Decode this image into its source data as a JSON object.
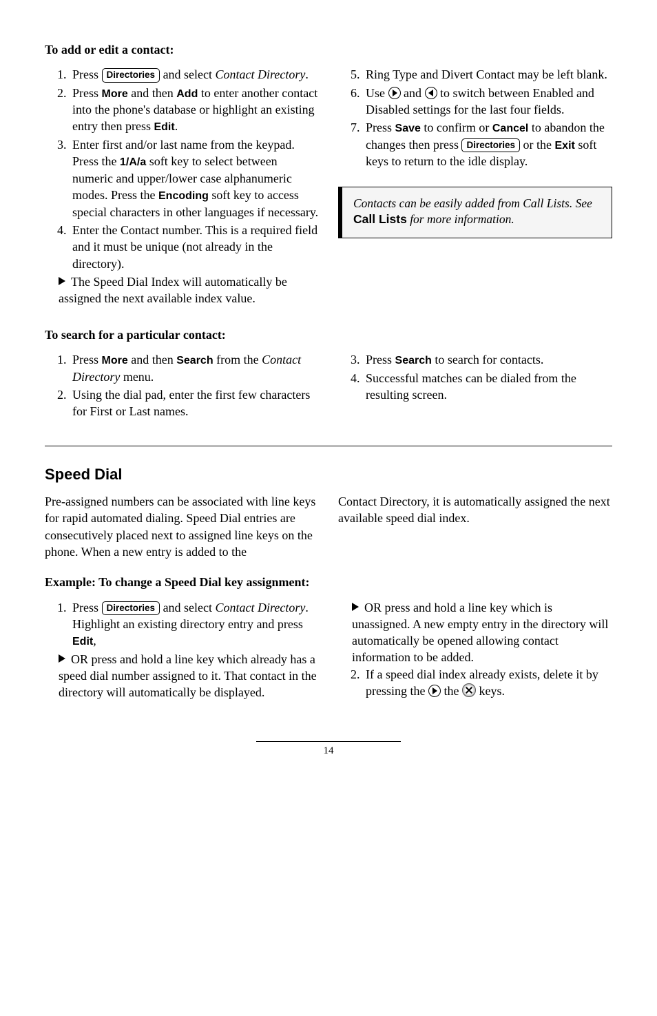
{
  "addEdit": {
    "heading": "To add or edit a contact:",
    "left": {
      "i1a": "Press ",
      "i1b": " and select ",
      "i1c": "Contact Directory",
      "i1d": ".",
      "i2a": "Press ",
      "i2b": " and then ",
      "i2c": " to enter another contact into the phone's database or highlight an existing entry then press ",
      "i2d": ".",
      "i3a": "Enter first and/or last name from the keypad.  Press the ",
      "i3b": " soft key to select between numeric and upper/lower case alphanumeric modes. Press the ",
      "i3c": " soft key to access special characters in other languages if necessary.",
      "i4": "Enter the Contact number.  This is a required field and it must be unique (not already in the directory).",
      "tri": "The Speed Dial Index will automatically be assigned the next available index value."
    },
    "right": {
      "i5": "Ring Type and Divert Contact may be left blank.",
      "i6a": "Use ",
      "i6b": " and ",
      "i6c": " to switch between Enabled and Disabled settings for the last four fields.",
      "i7a": "Press ",
      "i7b": " to confirm or ",
      "i7c": " to abandon the changes then press ",
      "i7d": " or the ",
      "i7e": " soft keys to return to the idle display."
    },
    "note": {
      "l1": "Contacts can be easily added from Call Lists.  See ",
      "bold": "Call Lists",
      "l2": " for more information."
    }
  },
  "search": {
    "heading": "To search for a particular contact:",
    "left": {
      "i1a": "Press ",
      "i1b": " and then ",
      "i1c": " from the ",
      "i1d": "Contact Directory",
      "i1e": " menu.",
      "i2": "Using the dial pad, enter the first few characters for First or Last names."
    },
    "right": {
      "i3a": "Press ",
      "i3b": " to search for contacts.",
      "i4": "Successful matches can be dialed from the resulting screen."
    }
  },
  "speedDial": {
    "heading": "Speed Dial",
    "p1": "Pre-assigned numbers can be associated with line keys for rapid automated dialing.  Speed Dial entries are consecutively placed next to assigned line keys on the phone.  When a new entry is added to the ",
    "p2": "Contact Directory, it is automatically assigned the next available speed dial index.",
    "sub": "Example: To change a Speed Dial key assignment:",
    "left": {
      "i1a": "Press ",
      "i1b": " and select ",
      "i1c": "Contact Directory",
      "i1d": ".  Highlight an existing directory entry and press ",
      "i1e": ",",
      "tri": "OR press and hold a line key which already has a speed dial number assigned to it.  That contact in the directory will automatically be displayed."
    },
    "right": {
      "tri": "OR press and hold a line key which is unassigned.  A new empty entry in the directory will automatically be opened allowing contact information to be added.",
      "i2a": "If a speed dial index already exists, delete it by pressing the ",
      "i2b": " the ",
      "i2c": " keys."
    }
  },
  "keys": {
    "directories": "Directories",
    "more": "More",
    "add": "Add",
    "edit": "Edit",
    "oneAa": "1/A/a",
    "encoding": "Encoding",
    "save": "Save",
    "cancel": "Cancel",
    "exit": "Exit",
    "search": "Search"
  },
  "pageNum": "14"
}
